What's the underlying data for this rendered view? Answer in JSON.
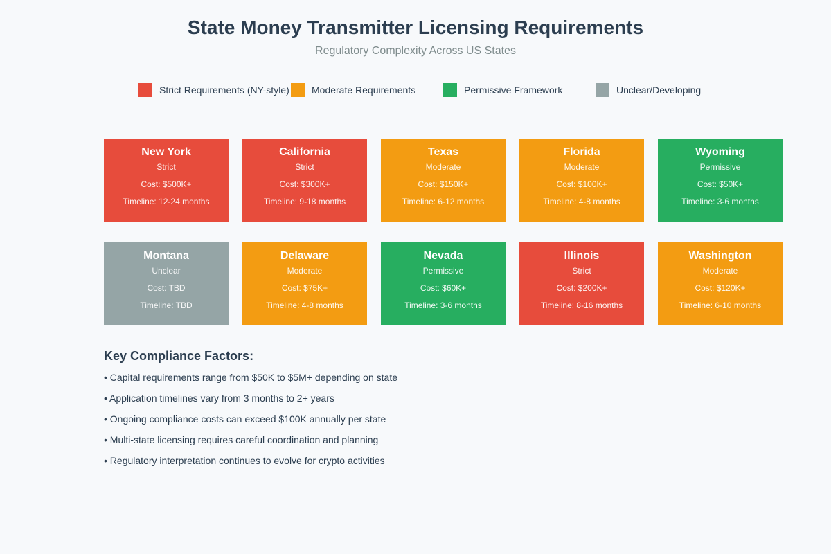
{
  "header": {
    "title": "State Money Transmitter Licensing Requirements",
    "subtitle": "Regulatory Complexity Across US States"
  },
  "legend": [
    {
      "label": "Strict Requirements (NY-style)",
      "color": "#e74c3c"
    },
    {
      "label": "Moderate Requirements",
      "color": "#f39c12"
    },
    {
      "label": "Permissive Framework",
      "color": "#27ae60"
    },
    {
      "label": "Unclear/Developing",
      "color": "#95a5a6"
    }
  ],
  "states": [
    {
      "name": "New York",
      "level": "Strict",
      "cost": "Cost: $500K+",
      "timeline": "Timeline: 12-24 months",
      "color": "#e74c3c"
    },
    {
      "name": "California",
      "level": "Strict",
      "cost": "Cost: $300K+",
      "timeline": "Timeline: 9-18 months",
      "color": "#e74c3c"
    },
    {
      "name": "Texas",
      "level": "Moderate",
      "cost": "Cost: $150K+",
      "timeline": "Timeline: 6-12 months",
      "color": "#f39c12"
    },
    {
      "name": "Florida",
      "level": "Moderate",
      "cost": "Cost: $100K+",
      "timeline": "Timeline: 4-8 months",
      "color": "#f39c12"
    },
    {
      "name": "Wyoming",
      "level": "Permissive",
      "cost": "Cost: $50K+",
      "timeline": "Timeline: 3-6 months",
      "color": "#27ae60"
    },
    {
      "name": "Montana",
      "level": "Unclear",
      "cost": "Cost: TBD",
      "timeline": "Timeline: TBD",
      "color": "#95a5a6"
    },
    {
      "name": "Delaware",
      "level": "Moderate",
      "cost": "Cost: $75K+",
      "timeline": "Timeline: 4-8 months",
      "color": "#f39c12"
    },
    {
      "name": "Nevada",
      "level": "Permissive",
      "cost": "Cost: $60K+",
      "timeline": "Timeline: 3-6 months",
      "color": "#27ae60"
    },
    {
      "name": "Illinois",
      "level": "Strict",
      "cost": "Cost: $200K+",
      "timeline": "Timeline: 8-16 months",
      "color": "#e74c3c"
    },
    {
      "name": "Washington",
      "level": "Moderate",
      "cost": "Cost: $120K+",
      "timeline": "Timeline: 6-10 months",
      "color": "#f39c12"
    }
  ],
  "factors": {
    "heading": "Key Compliance Factors:",
    "items": [
      "• Capital requirements range from $50K to $5M+ depending on state",
      "• Application timelines vary from 3 months to 2+ years",
      "• Ongoing compliance costs can exceed $100K annually per state",
      "• Multi-state licensing requires careful coordination and planning",
      "• Regulatory interpretation continues to evolve for crypto activities"
    ]
  }
}
